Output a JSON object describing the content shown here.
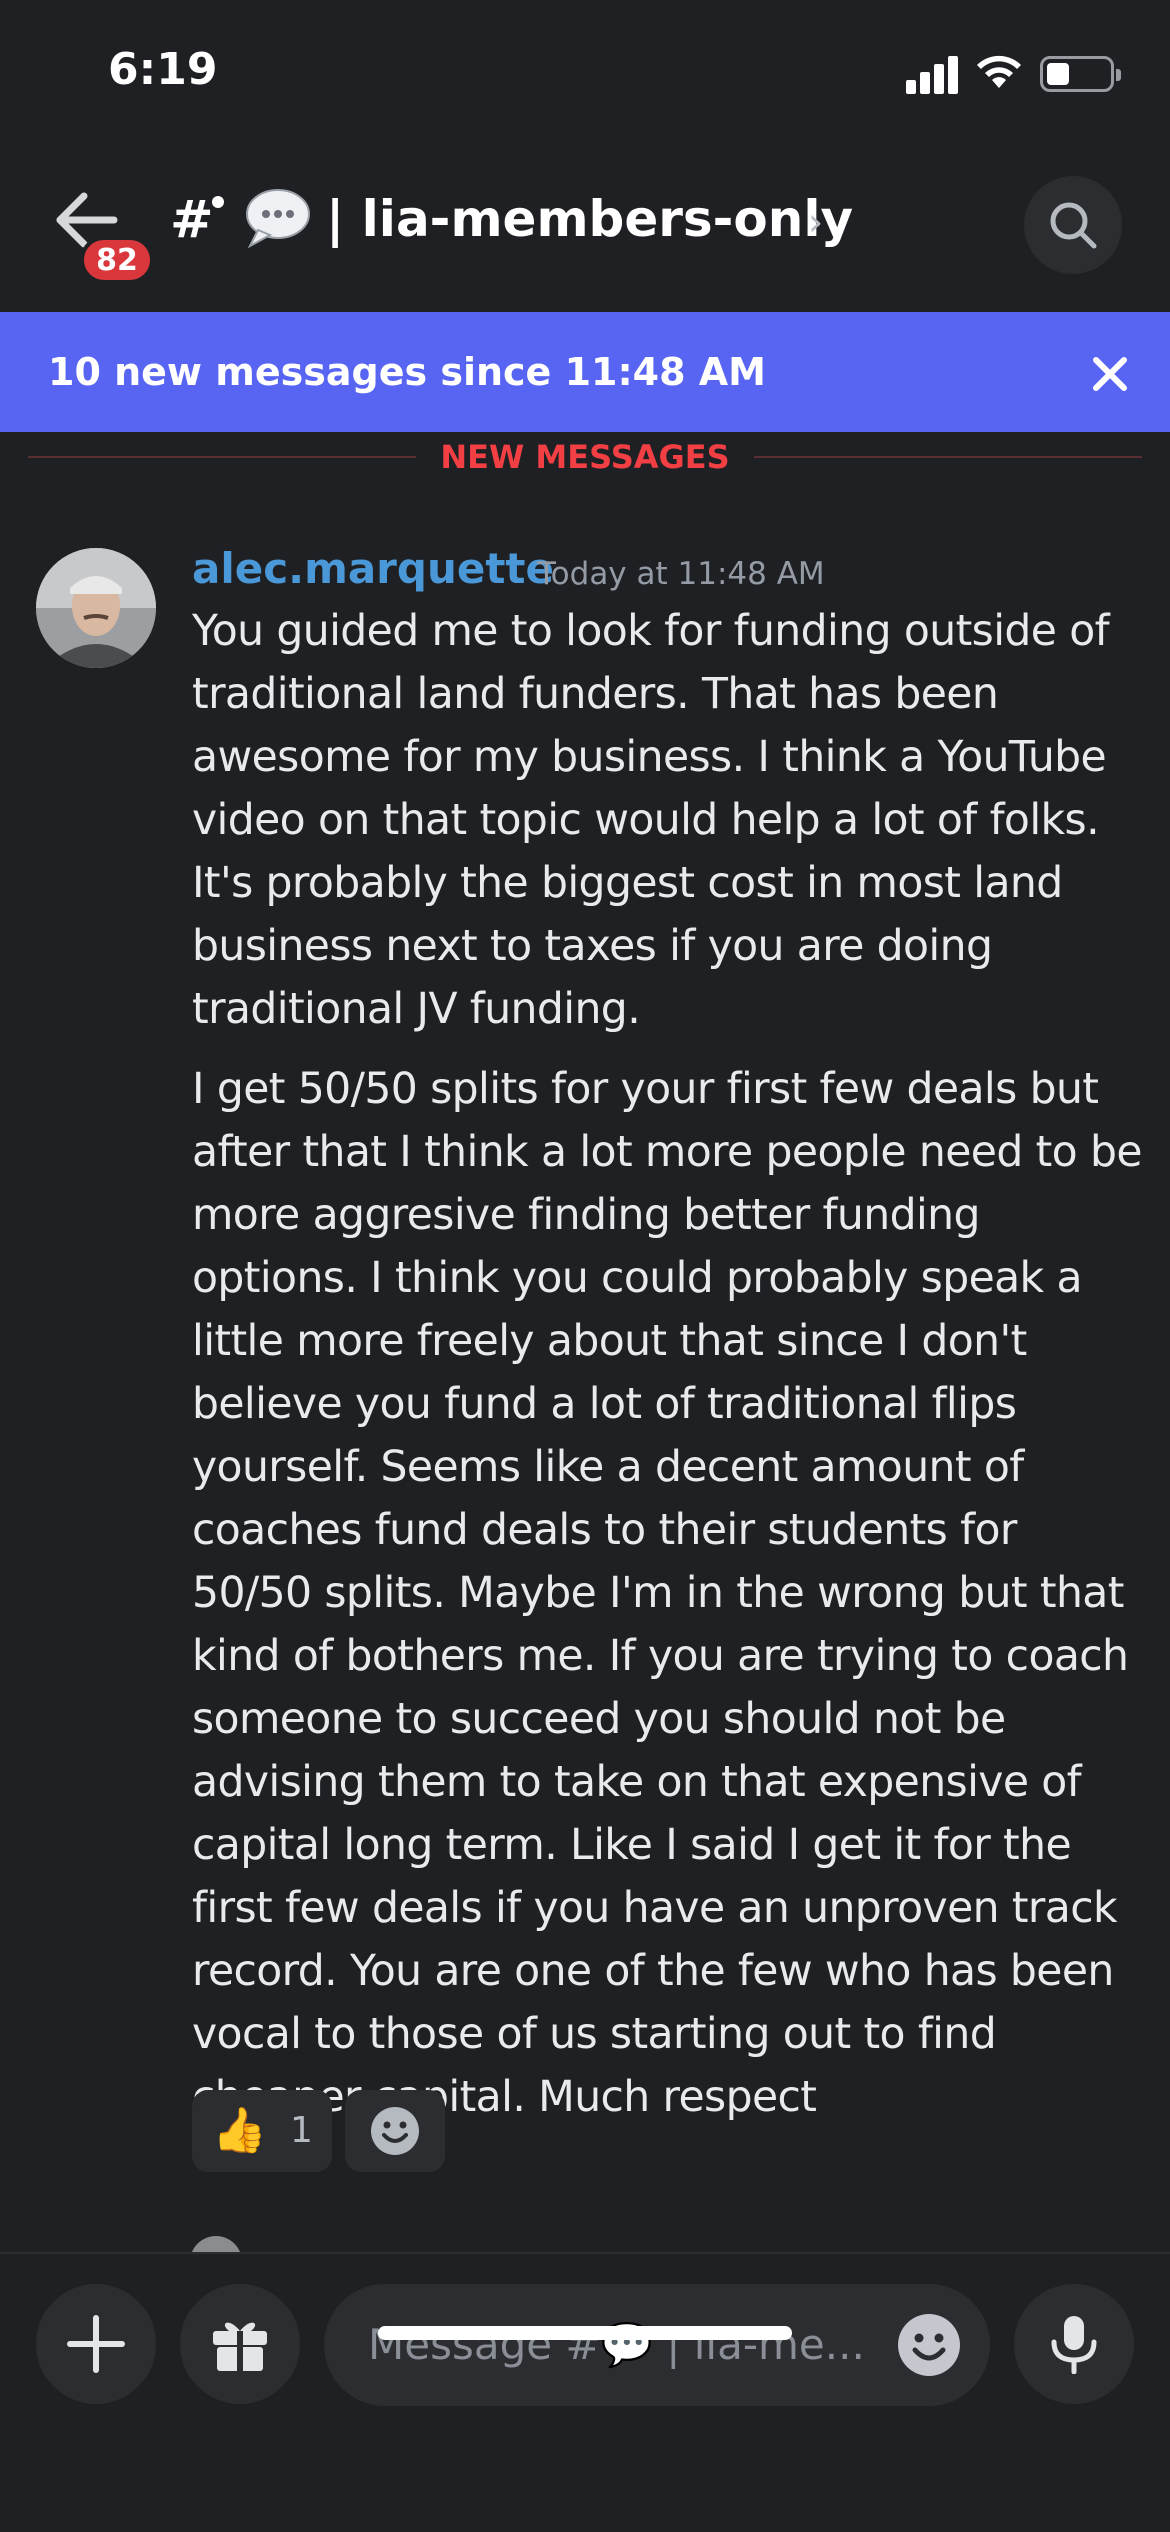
{
  "status_bar": {
    "time": "6:19",
    "icons": [
      "signal-icon",
      "wifi-icon",
      "battery-icon"
    ]
  },
  "header": {
    "back_badge": "82",
    "channel_prefix": "#",
    "channel_title": "| lia-members-only",
    "chevron": "›",
    "icons": [
      "back-arrow-icon",
      "speech-bubble-emoji-icon",
      "search-icon"
    ]
  },
  "banner": {
    "text": "10 new messages since 11:48 AM",
    "close": "✕"
  },
  "divider": {
    "label": "NEW MESSAGES"
  },
  "message": {
    "author": "alec.marquette",
    "timestamp": "Today at 11:48 AM",
    "paragraphs": [
      "You guided me to look for funding outside of traditional land funders. That has been awesome for my business. I think a YouTube video on that topic would help a lot of folks. It's probably the biggest cost in most land business next to taxes if you are doing traditional JV funding.",
      "I get 50/50 splits for your first few deals but after that I think a lot more people need to be more aggresive finding better funding options. I think you could probably speak a little more freely about that since I don't believe you fund a lot of traditional flips yourself. Seems like a decent amount of coaches fund deals to their students for 50/50 splits. Maybe I'm in the wrong but that kind of bothers me. If you are trying to coach someone to succeed you should not be advising them to take on that expensive of capital long term. Like I said I get it for the first few deals if you have an unproven track record. You are one of the few who has been vocal to those of us starting out to find cheaper capital. Much respect"
    ],
    "reactions": [
      {
        "emoji": "👍",
        "count": "1"
      }
    ]
  },
  "composer": {
    "placeholder": "Message #💬 | lia-me...",
    "icons": [
      "plus-icon",
      "gift-icon",
      "emoji-icon",
      "microphone-icon"
    ]
  },
  "colors": {
    "background": "#1f2024",
    "banner": "#5865f2",
    "badge": "#da373c",
    "author": "#4a98d8",
    "new_messages": "#f23f43"
  }
}
